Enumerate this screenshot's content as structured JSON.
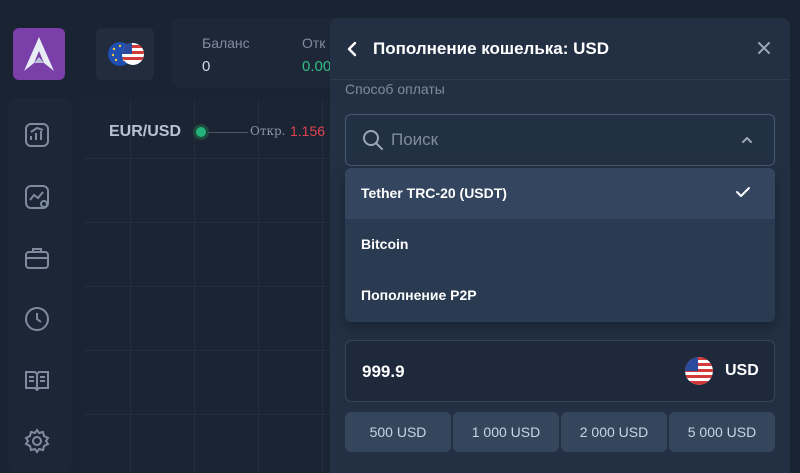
{
  "header": {
    "balance_label": "Баланс",
    "balance_value": "0",
    "otk_label": "Отк",
    "otk_value": "0.00"
  },
  "chart": {
    "pair": "EUR/USD",
    "open_label": "Откр.",
    "open_value": "1.156"
  },
  "drawer": {
    "title": "Пополнение кошелька: USD",
    "method_label": "Способ оплаты",
    "search_placeholder": "Поиск",
    "methods": [
      {
        "label": "Tether TRC-20 (USDT)",
        "selected": true
      },
      {
        "label": "Bitcoin",
        "selected": false
      },
      {
        "label": "Пополнение P2P",
        "selected": false
      }
    ],
    "amount": "999.9",
    "amount_currency": "USD",
    "presets": [
      "500 USD",
      "1 000 USD",
      "2 000 USD",
      "5 000 USD"
    ]
  },
  "colors": {
    "accent_positive": "#2fbf84",
    "accent_negative": "#e0454f",
    "logo": "#7a3fa8"
  },
  "icons": [
    "app-logo-icon",
    "chart-up-icon",
    "chart-star-icon",
    "briefcase-icon",
    "clock-icon",
    "book-icon",
    "gear-icon",
    "eu-us-flag-icon",
    "back-arrow-icon",
    "close-icon",
    "search-icon",
    "chevron-up-icon",
    "check-icon",
    "us-flag-icon"
  ]
}
